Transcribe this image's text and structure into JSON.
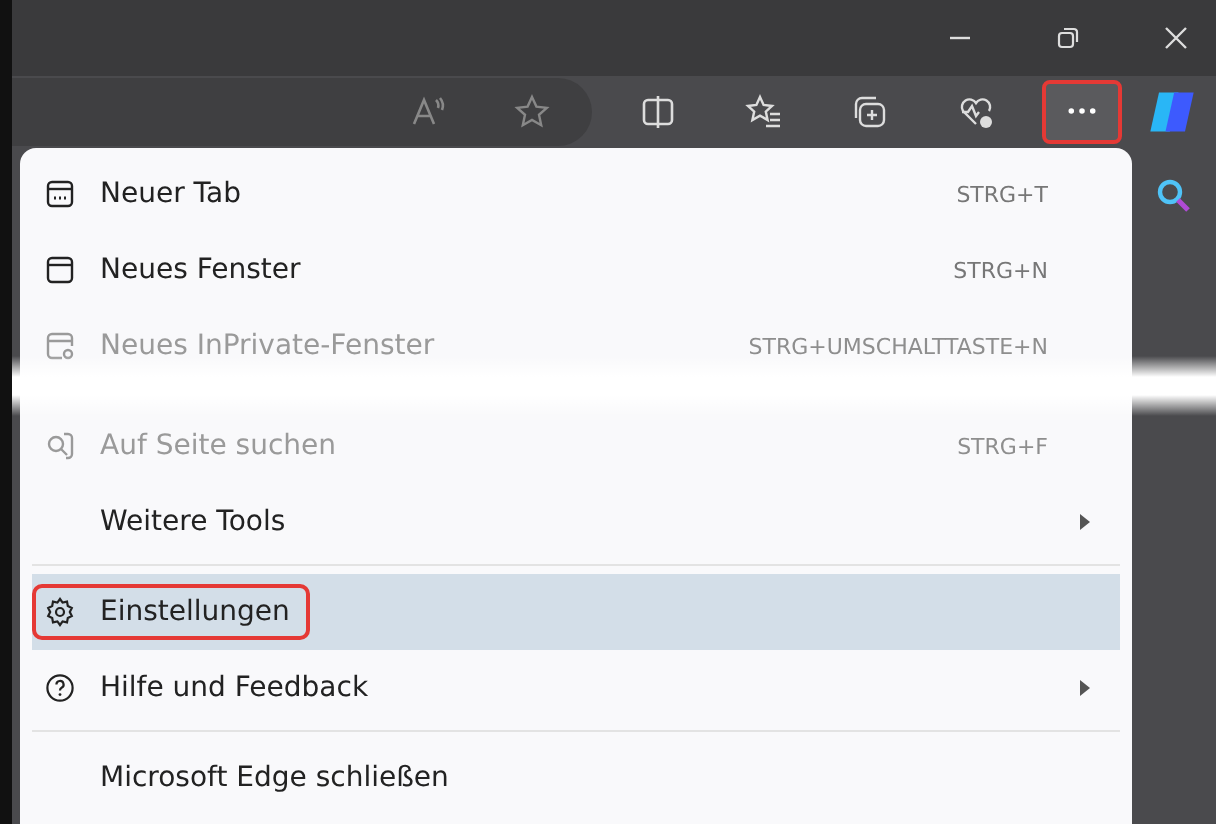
{
  "toolbar": {
    "more_button": {
      "highlighted": true
    }
  },
  "menu": {
    "items": [
      {
        "label": "Neuer Tab",
        "shortcut": "STRG+T",
        "faded": false,
        "selected": false,
        "highlighted": false,
        "submenu": false,
        "separator_above": false
      },
      {
        "label": "Neues Fenster",
        "shortcut": "STRG+N",
        "faded": false,
        "selected": false,
        "highlighted": false,
        "submenu": false,
        "separator_above": false
      },
      {
        "label": "Neues InPrivate-Fenster",
        "shortcut": "STRG+UMSCHALTTASTE+N",
        "faded": true,
        "selected": false,
        "highlighted": false,
        "submenu": false,
        "separator_above": false
      },
      {
        "label": "Auf Seite suchen",
        "shortcut": "STRG+F",
        "faded": true,
        "selected": false,
        "highlighted": false,
        "submenu": false,
        "separator_above": false
      },
      {
        "label": "Weitere Tools",
        "faded": false,
        "selected": false,
        "highlighted": false,
        "submenu": true,
        "separator_above": false
      },
      {
        "label": "Einstellungen",
        "faded": false,
        "selected": true,
        "highlighted": true,
        "submenu": false,
        "separator_above": true
      },
      {
        "label": "Hilfe und Feedback",
        "faded": false,
        "selected": false,
        "highlighted": false,
        "submenu": true,
        "separator_above": false
      },
      {
        "label": "Microsoft Edge schließen",
        "faded": false,
        "selected": false,
        "highlighted": false,
        "submenu": false,
        "separator_above": true
      }
    ]
  }
}
